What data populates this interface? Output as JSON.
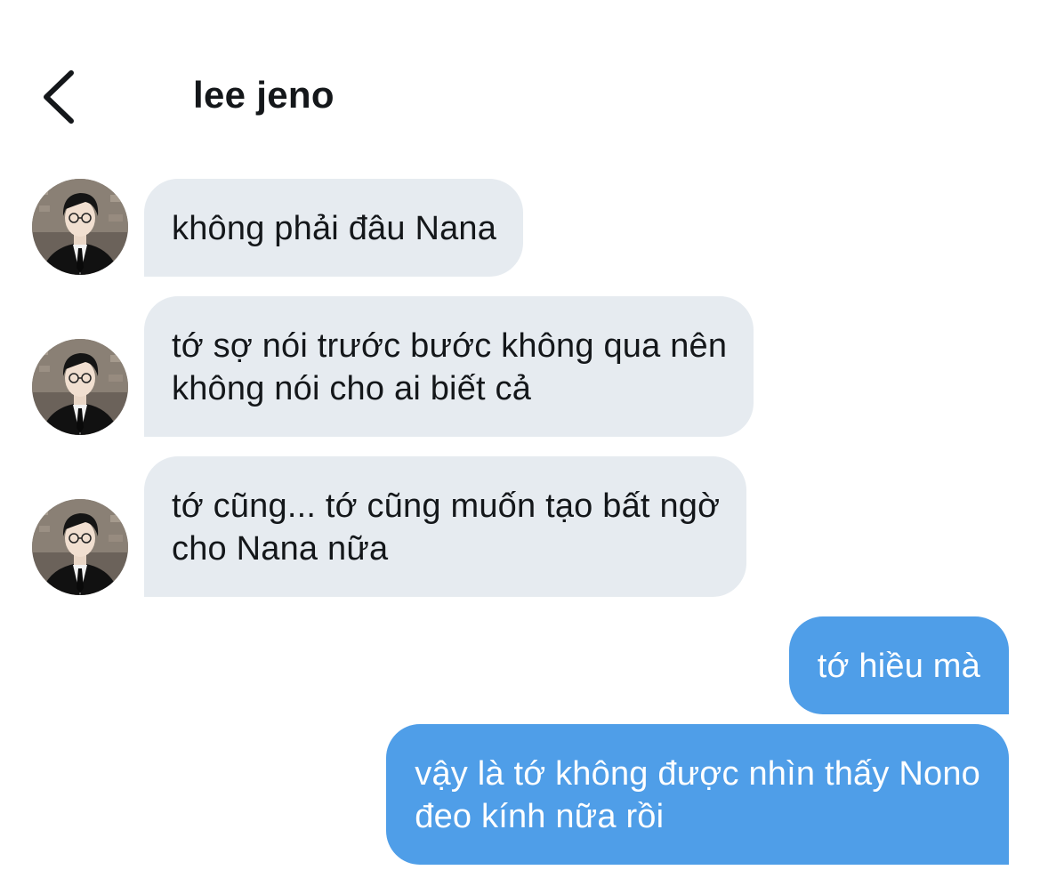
{
  "header": {
    "title": "lee jeno",
    "back_icon": "chevron-left-icon"
  },
  "messages": [
    {
      "sender": "lee jeno",
      "direction": "incoming",
      "text": "không phải đâu Nana"
    },
    {
      "sender": "lee jeno",
      "direction": "incoming",
      "text": "tớ sợ nói trước bước không qua nên\nkhông nói cho ai biết cả"
    },
    {
      "sender": "lee jeno",
      "direction": "incoming",
      "text": "tớ cũng... tớ cũng muốn tạo bất ngờ\ncho Nana nữa"
    },
    {
      "sender": "me",
      "direction": "outgoing",
      "text": "tớ hiều mà"
    },
    {
      "sender": "me",
      "direction": "outgoing",
      "text": "vậy là tớ không được nhìn thấy Nono\nđeo kính nữa rồi"
    }
  ],
  "colors": {
    "incoming_bubble": "#e6ebf0",
    "outgoing_bubble": "#4f9ee8",
    "outgoing_text": "#ffffff",
    "text": "#14171a"
  }
}
